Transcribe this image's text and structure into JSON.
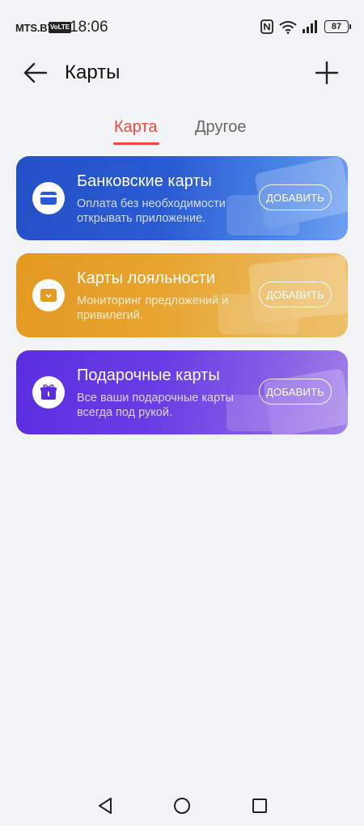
{
  "status_bar": {
    "carrier": "MTS.BY",
    "volte": "VoLTE",
    "time": "18:06",
    "battery": "87",
    "icons": [
      "nfc-icon",
      "wifi-icon",
      "signal-icon",
      "battery-icon"
    ]
  },
  "header": {
    "title": "Карты",
    "back_icon": "arrow-left-icon",
    "add_icon": "plus-icon"
  },
  "tabs": [
    {
      "label": "Карта",
      "active": true
    },
    {
      "label": "Другое",
      "active": false
    }
  ],
  "accent_color": "#e84a3f",
  "cards": [
    {
      "title": "Банковские карты",
      "description": "Оплата без необходимости открывать приложение.",
      "button": "ДОБАВИТЬ",
      "icon": "credit-card-icon",
      "color": "#2450c6"
    },
    {
      "title": "Карты лояльности",
      "description": "Мониторинг предложений и привилегий.",
      "button": "ДОБАВИТЬ",
      "icon": "loyalty-card-icon",
      "color": "#e39a22"
    },
    {
      "title": "Подарочные карты",
      "description": "Все ваши подарочные карты всегда под рукой.",
      "button": "ДОБАВИТЬ",
      "icon": "gift-icon",
      "color": "#5a2ee0"
    }
  ],
  "nav_bar": {
    "icons": [
      "nav-back-icon",
      "nav-home-icon",
      "nav-recent-icon"
    ]
  }
}
